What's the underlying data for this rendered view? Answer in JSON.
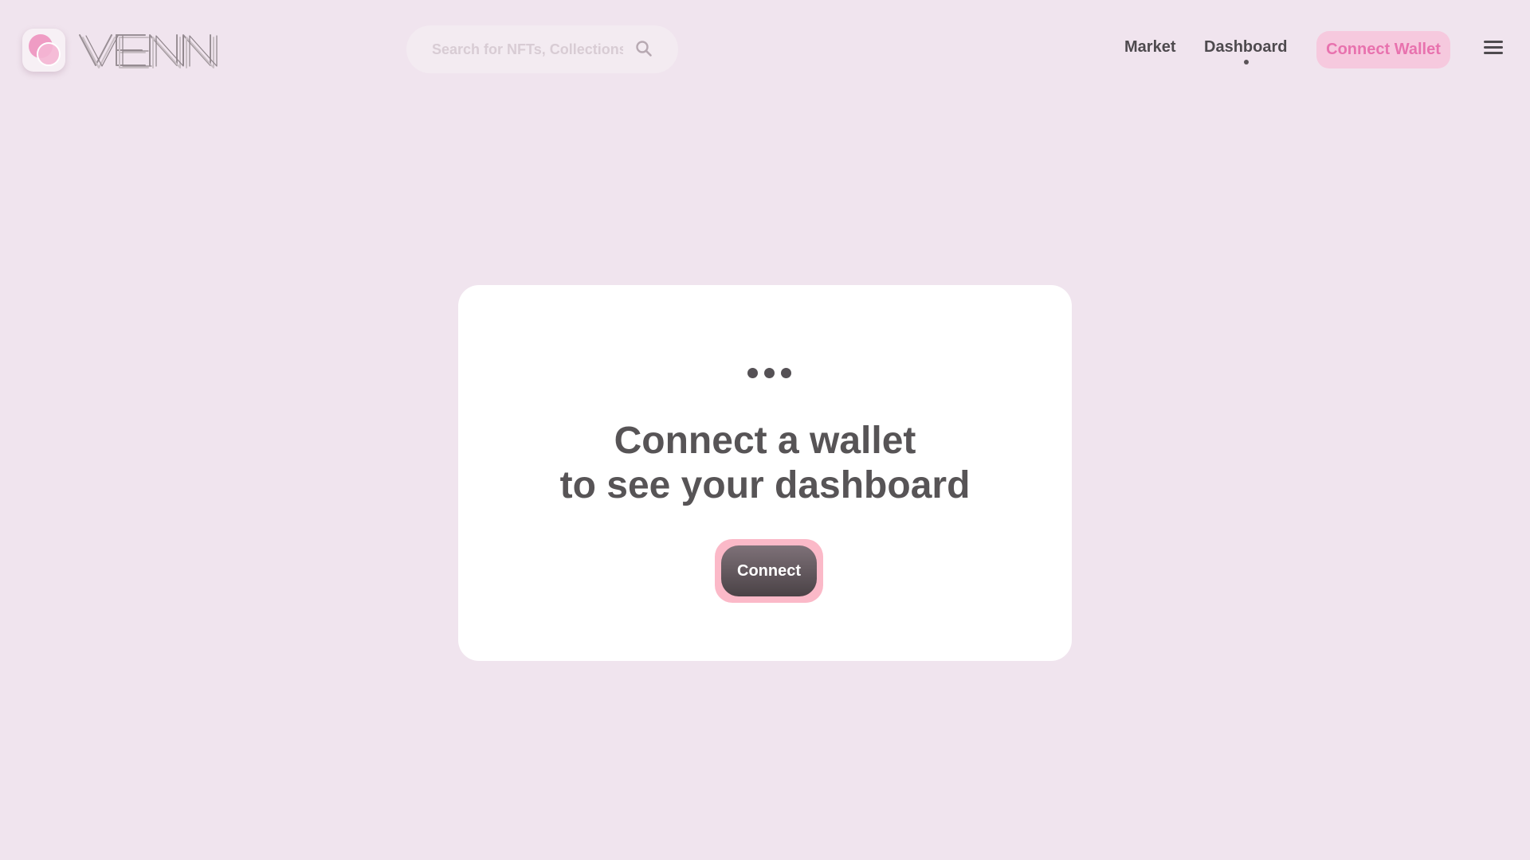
{
  "brand": {
    "logo_icon": "venn-circles-logo-icon",
    "wordmark": "VENN",
    "colors": {
      "pink": "#e872ae",
      "light_pink": "#f6c9de"
    }
  },
  "search": {
    "placeholder": "Search for NFTs, Collections",
    "icon": "search-icon"
  },
  "nav": {
    "market_label": "Market",
    "dashboard_label": "Dashboard",
    "active_item": "Dashboard",
    "connect_wallet_label": "Connect Wallet",
    "menu_icon": "hamburger-menu-icon"
  },
  "card": {
    "icon": "ellipsis-icon",
    "title_line1": "Connect a wallet",
    "title_line2": "to see your dashboard",
    "connect_label": "Connect"
  },
  "colors": {
    "background": "#f0e4ee",
    "text": "#575456",
    "button_dark": "#4a4246",
    "button_ring": "#fbb9c8"
  }
}
